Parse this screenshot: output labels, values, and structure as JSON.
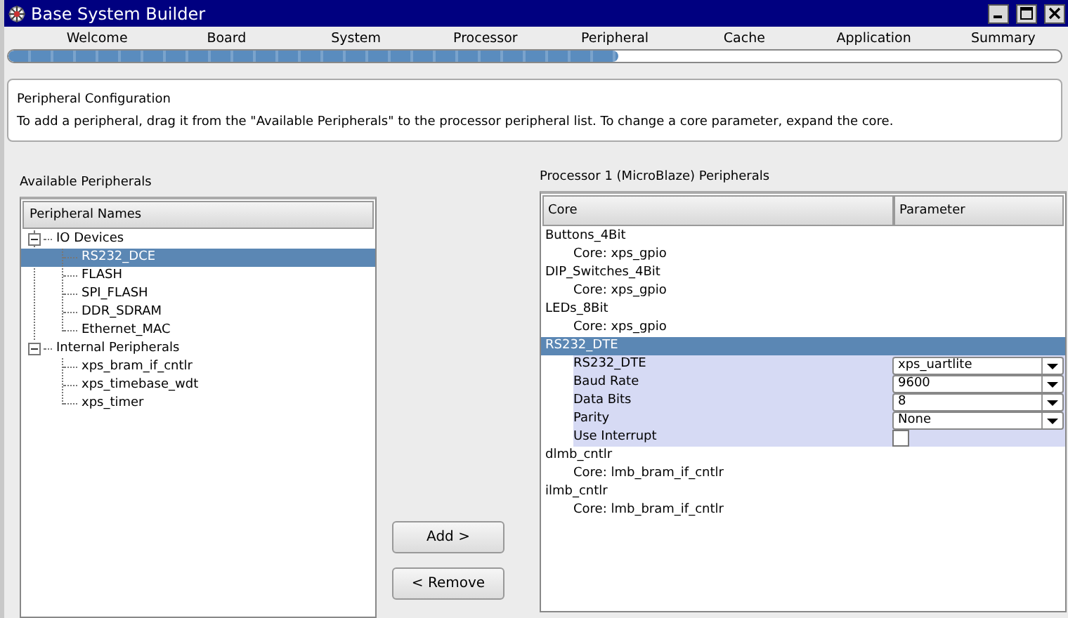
{
  "window": {
    "title": "Base System Builder"
  },
  "steps": [
    "Welcome",
    "Board",
    "System",
    "Processor",
    "Peripheral",
    "Cache",
    "Application",
    "Summary"
  ],
  "progress": {
    "level": 0.58
  },
  "info": {
    "title": "Peripheral Configuration",
    "text": "To add a peripheral, drag it from the \"Available Peripherals\" to the processor peripheral list. To change a core parameter, expand the core."
  },
  "available": {
    "label": "Available Peripherals",
    "header": "Peripheral Names",
    "groups": [
      {
        "label": "IO Devices",
        "expanded": true,
        "children": [
          {
            "label": "RS232_DCE",
            "selected": true
          },
          {
            "label": "FLASH",
            "selected": false
          },
          {
            "label": "SPI_FLASH",
            "selected": false
          },
          {
            "label": "DDR_SDRAM",
            "selected": false
          },
          {
            "label": "Ethernet_MAC",
            "selected": false
          }
        ]
      },
      {
        "label": "Internal Peripherals",
        "expanded": true,
        "children": [
          {
            "label": "xps_bram_if_cntlr",
            "selected": false
          },
          {
            "label": "xps_timebase_wdt",
            "selected": false
          },
          {
            "label": "xps_timer",
            "selected": false
          }
        ]
      }
    ]
  },
  "buttons": [
    "Add >",
    "< Remove"
  ],
  "processor": {
    "label": "Processor 1 (MicroBlaze) Peripherals",
    "columns": [
      "Core",
      "Parameter"
    ],
    "peripherals": [
      {
        "name": "Buttons_4Bit",
        "selected": false,
        "core": "Core: xps_gpio"
      },
      {
        "name": "DIP_Switches_4Bit",
        "selected": false,
        "core": "Core: xps_gpio"
      },
      {
        "name": "LEDs_8Bit",
        "selected": false,
        "core": "Core: xps_gpio"
      },
      {
        "name": "RS232_DTE",
        "selected": true,
        "params": [
          {
            "kind": "select",
            "name": "RS232_DTE",
            "value": "xps_uartlite"
          },
          {
            "kind": "select",
            "name": "Baud Rate",
            "value": "9600"
          },
          {
            "kind": "select",
            "name": "Data Bits",
            "value": "8"
          },
          {
            "kind": "select",
            "name": "Parity",
            "value": "None"
          },
          {
            "kind": "checkbox",
            "name": "Use Interrupt",
            "checked": false
          }
        ]
      },
      {
        "name": "dlmb_cntlr",
        "selected": false,
        "core": "Core: lmb_bram_if_cntlr"
      },
      {
        "name": "ilmb_cntlr",
        "selected": false,
        "core": "Core: lmb_bram_if_cntlr"
      }
    ]
  }
}
